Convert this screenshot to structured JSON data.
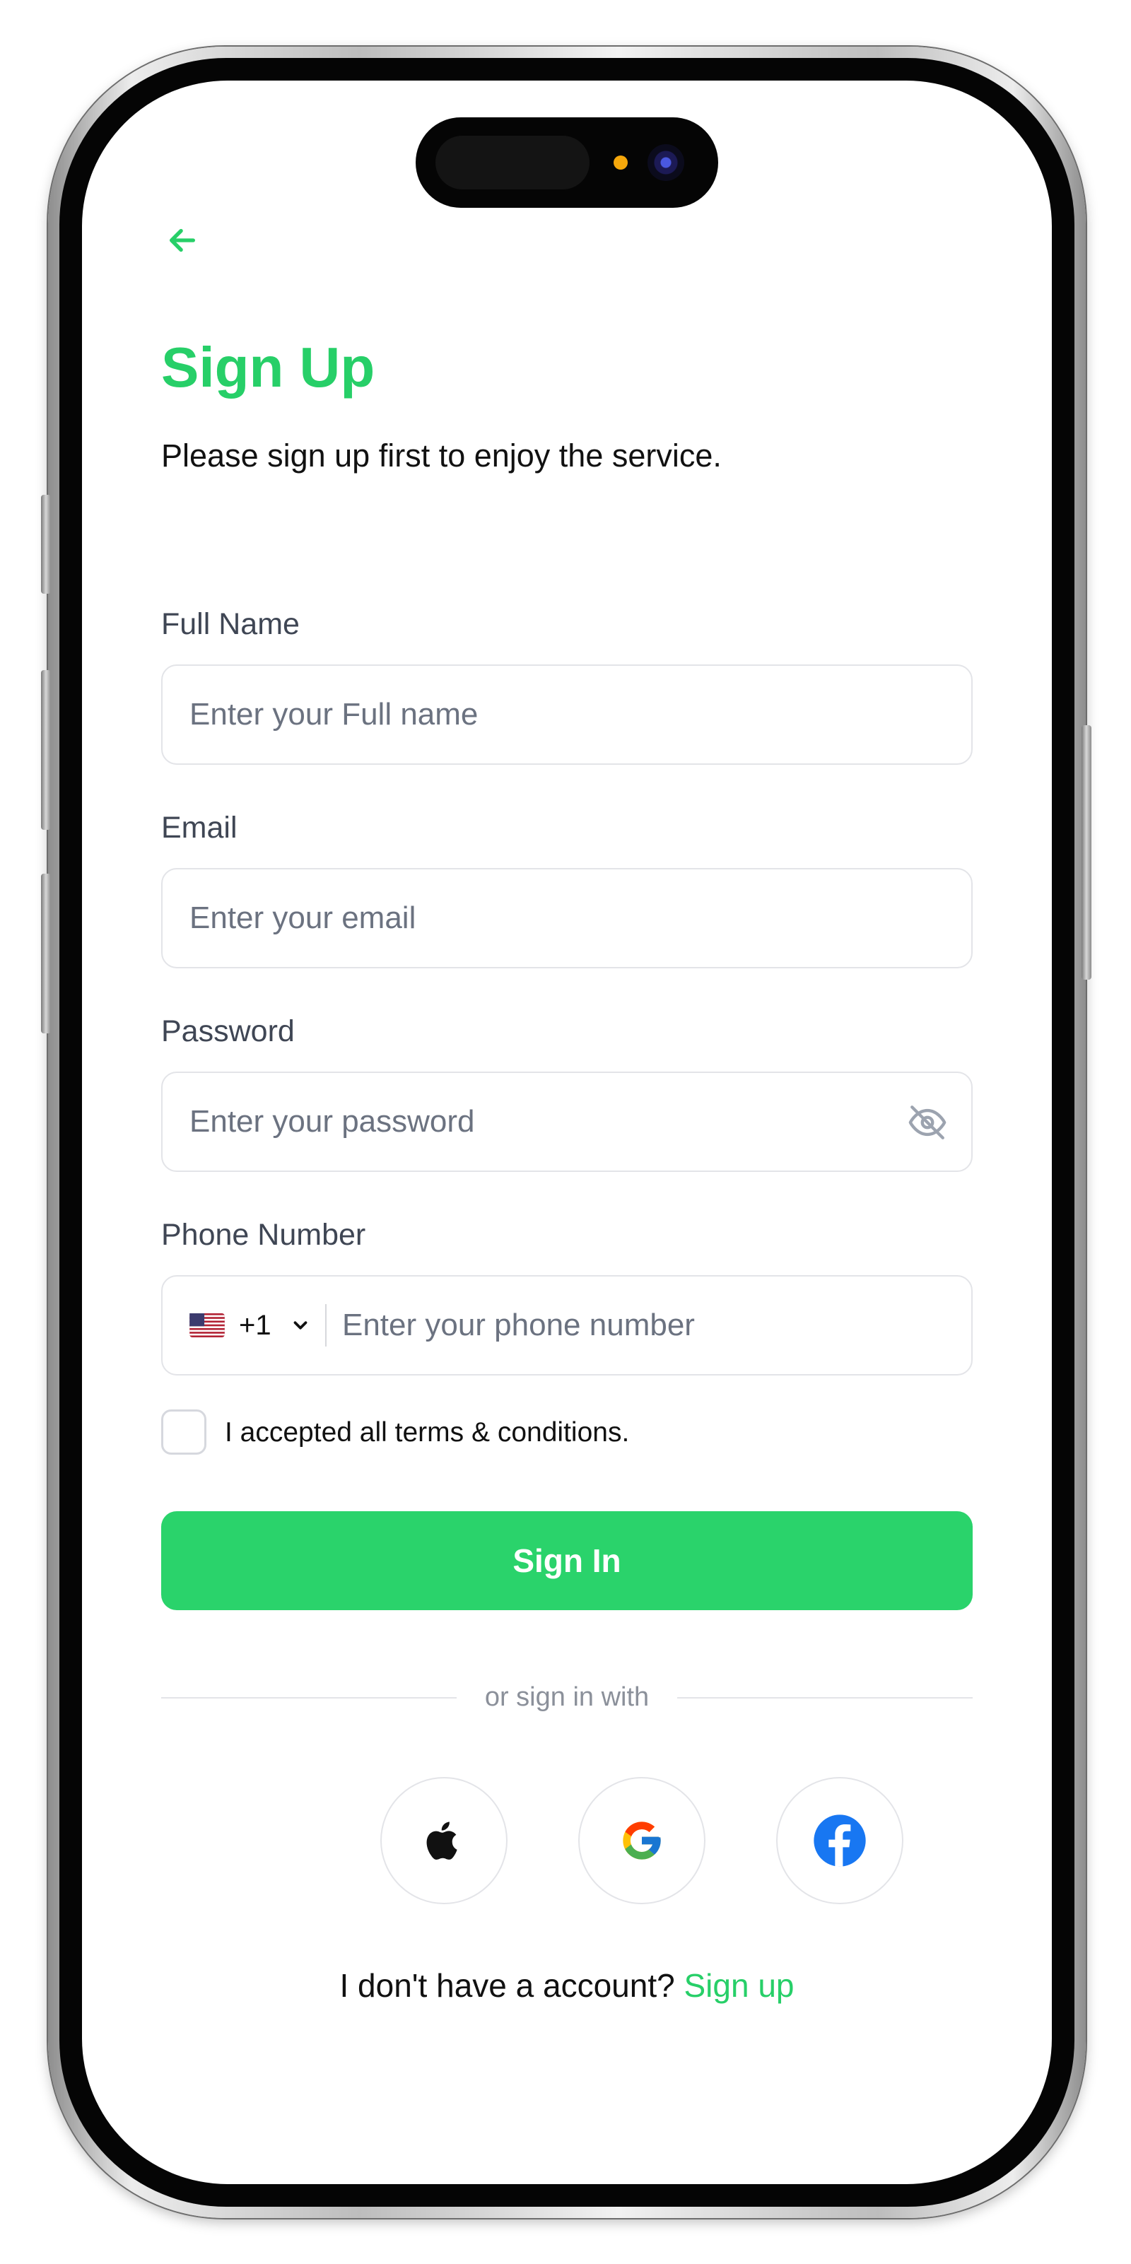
{
  "theme": {
    "accent": "#27cf68",
    "button": "#2ad36b",
    "border": "#e3e4e8",
    "placeholder": "#6b7280",
    "label": "#3f4654"
  },
  "header": {
    "back_icon": "arrow-left-icon"
  },
  "title": "Sign Up",
  "subtitle": "Please sign up first to enjoy the service.",
  "fields": {
    "full_name": {
      "label": "Full Name",
      "placeholder": "Enter your Full name",
      "value": ""
    },
    "email": {
      "label": "Email",
      "placeholder": "Enter your email",
      "value": ""
    },
    "password": {
      "label": "Password",
      "placeholder": "Enter your password",
      "value": "",
      "toggle_icon": "eye-off-icon"
    },
    "phone": {
      "label": "Phone Number",
      "placeholder": "Enter your phone number",
      "value": "",
      "country_flag": "us-flag-icon",
      "dial_code": "+1"
    }
  },
  "terms": {
    "checked": false,
    "label": "I accepted all terms & conditions."
  },
  "primary_button": "Sign In",
  "divider": "or sign in with",
  "social": [
    {
      "name": "Apple",
      "icon": "apple-icon"
    },
    {
      "name": "Google",
      "icon": "google-icon"
    },
    {
      "name": "Facebook",
      "icon": "facebook-icon"
    }
  ],
  "footer": {
    "prompt": "I don't have a account?",
    "link": "Sign up"
  }
}
